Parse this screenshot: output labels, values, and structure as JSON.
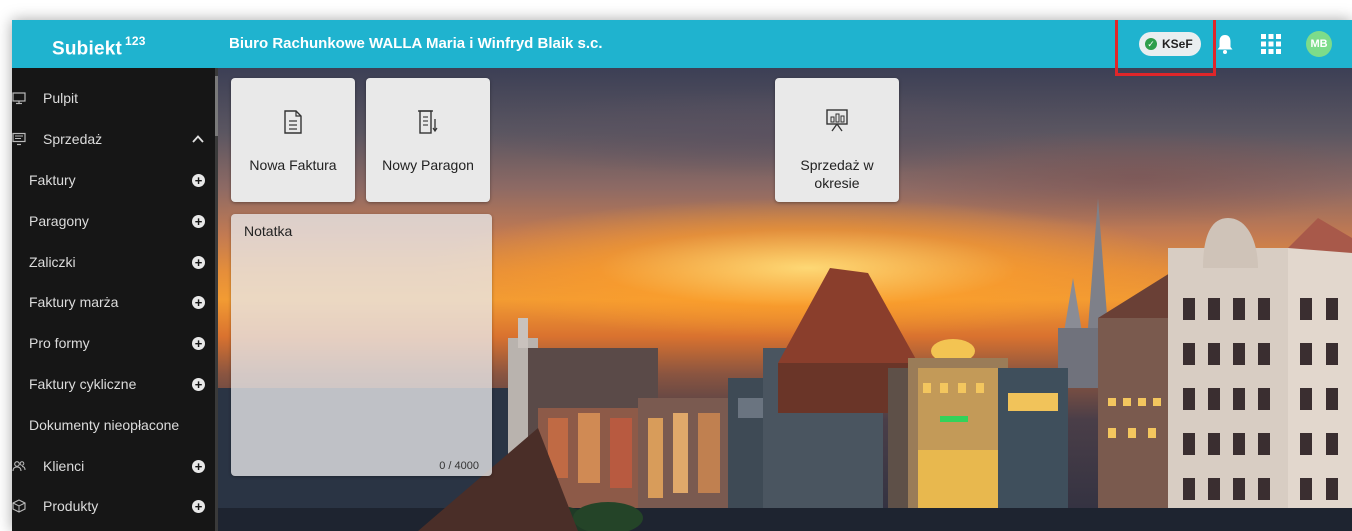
{
  "app": {
    "logo_text": "Subiekt",
    "logo_sup": "123",
    "company_name": "Biuro Rachunkowe WALLA Maria i Winfryd Blaik s.c."
  },
  "header": {
    "ksef_label": "KSeF",
    "ksef_status": "connected",
    "bell_icon": "bell-icon",
    "apps_icon": "apps-grid-icon",
    "avatar_initials": "MB",
    "accent_color": "#1fb3cf",
    "highlight_color": "#e0262a"
  },
  "sidebar": {
    "items": [
      {
        "label": "Pulpit",
        "icon": "desktop-icon"
      },
      {
        "label": "Sprzedaż",
        "icon": "register-icon",
        "expanded": true
      },
      {
        "label": "Faktury",
        "has_add": true
      },
      {
        "label": "Paragony",
        "has_add": true
      },
      {
        "label": "Zaliczki",
        "has_add": true
      },
      {
        "label": "Faktury marża",
        "has_add": true
      },
      {
        "label": "Pro formy",
        "has_add": true
      },
      {
        "label": "Faktury cykliczne",
        "has_add": true
      },
      {
        "label": "Dokumenty nieopłacone"
      },
      {
        "label": "Klienci",
        "icon": "clients-icon",
        "has_add": true
      },
      {
        "label": "Produkty",
        "icon": "products-icon",
        "has_add": true
      }
    ]
  },
  "tiles": {
    "new_invoice": "Nowa Faktura",
    "new_receipt": "Nowy Paragon",
    "sales_period": "Sprzedaż w okresie"
  },
  "note": {
    "title": "Notatka",
    "counter": "0 / 4000"
  }
}
